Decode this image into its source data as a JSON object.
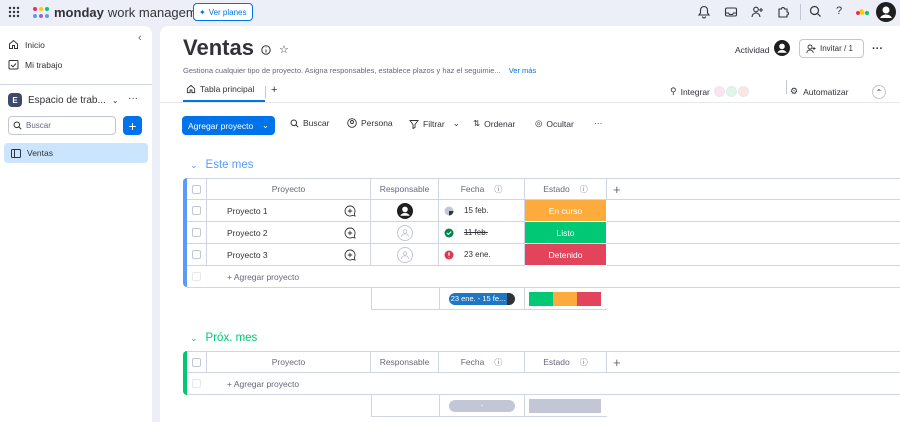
{
  "topbar": {
    "brand_bold": "monday",
    "brand_rest": "work management",
    "plans_label": "Ver planes"
  },
  "sidebar": {
    "items": [
      {
        "label": "Inicio",
        "icon": "home-icon"
      },
      {
        "label": "Mi trabajo",
        "icon": "calendar-check-icon"
      }
    ],
    "workspace": {
      "badge": "E",
      "label": "Espacio de trab..."
    },
    "search_placeholder": "Buscar",
    "boards": [
      {
        "label": "Ventas"
      }
    ]
  },
  "board": {
    "title": "Ventas",
    "description": "Gestiona cualquier tipo de proyecto. Asigna responsables, establece plazos y haz el seguimie...",
    "more_link": "Ver más",
    "activity_label": "Actividad",
    "invite_label": "Invitar / 1",
    "tab_label": "Tabla principal",
    "integrate_label": "Integrar",
    "automate_label": "Automatizar"
  },
  "toolbar": {
    "add_label": "Agregar proyecto",
    "search": "Buscar",
    "person": "Persona",
    "filter": "Filtrar",
    "sort": "Ordenar",
    "hide": "Ocultar",
    "more": "···"
  },
  "columns": {
    "project": "Proyecto",
    "owner": "Responsable",
    "date": "Fecha",
    "status": "Estado"
  },
  "groups": [
    {
      "title": "Este mes",
      "color": "#579bfc",
      "rows": [
        {
          "name": "Proyecto 1",
          "date": "15 feb.",
          "status": "En curso",
          "status_color": "#fdab3d",
          "date_state": "half-clock"
        },
        {
          "name": "Proyecto 2",
          "date": "11 feb.",
          "status": "Listo",
          "status_color": "#00c875",
          "date_state": "done"
        },
        {
          "name": "Proyecto 3",
          "date": "23 ene.",
          "status": "Detenido",
          "status_color": "#e2445c",
          "date_state": "overdue"
        }
      ],
      "add_row": "+ Agregar proyecto",
      "summary_date": "23 ene. - 15 fe...",
      "summary_status": [
        {
          "color": "#00c875",
          "fraction": 0.3333
        },
        {
          "color": "#fdab3d",
          "fraction": 0.3333
        },
        {
          "color": "#e2445c",
          "fraction": 0.3333
        }
      ]
    },
    {
      "title": "Próx. mes",
      "color": "#00c875",
      "rows": [],
      "add_row": "+ Agregar proyecto",
      "summary_date": "-",
      "summary_status": []
    }
  ]
}
